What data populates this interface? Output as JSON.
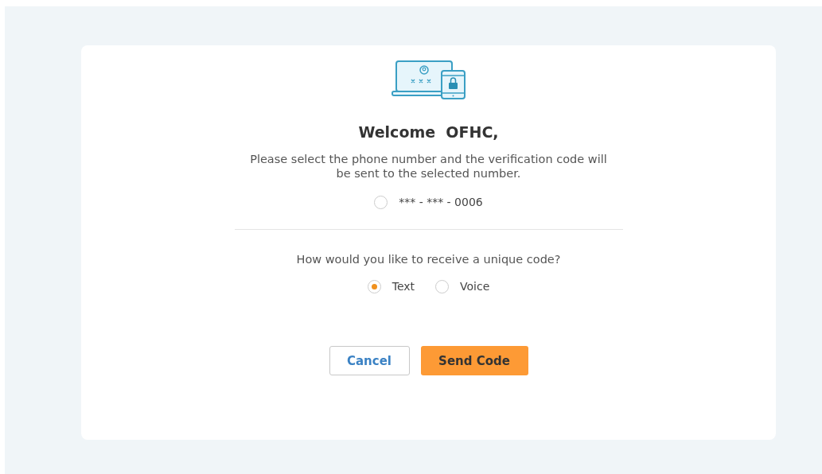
{
  "title": "Welcome  OFHC,",
  "instructions": "Please select the phone number and the verification code will be sent to the selected number.",
  "phones": [
    {
      "label": "*** - *** - 0006",
      "selected": false
    }
  ],
  "question": "How would you like to receive a unique code?",
  "methods": [
    {
      "label": "Text",
      "selected": true
    },
    {
      "label": "Voice",
      "selected": false
    }
  ],
  "buttons": [
    {
      "label": "Cancel",
      "kind": "secondary"
    },
    {
      "label": "Send Code",
      "kind": "primary"
    }
  ]
}
